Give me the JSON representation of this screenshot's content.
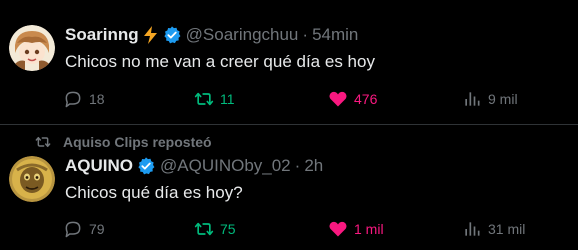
{
  "tweets": [
    {
      "author_name": "Soarinng",
      "handle": "@Soaringchuu",
      "separator": "·",
      "time": "54min",
      "text": "Chicos no me van a creer qué día es hoy",
      "reply_count": "18",
      "retweet_count": "11",
      "like_count": "476",
      "view_count": "9 mil",
      "liked": true,
      "retweeted": true
    },
    {
      "repost_text": "Aquiso Clips reposteó",
      "author_name": "AQUINO",
      "handle": "@AQUINOby_02",
      "separator": "·",
      "time": "2h",
      "text": "Chicos qué día es hoy?",
      "reply_count": "79",
      "retweet_count": "75",
      "like_count": "1 mil",
      "view_count": "31 mil",
      "liked": true,
      "retweeted": true
    }
  ],
  "colors": {
    "background": "#000000",
    "text_primary": "#e7e9ea",
    "text_secondary": "#71767b",
    "verified_blue": "#1d9bf0",
    "retweet_green": "#00ba7c",
    "like_pink": "#f91880",
    "divider": "#2f3336"
  },
  "icons": {
    "emoji": "lightning-emoji-icon",
    "verified": "verified-badge-icon",
    "reply": "reply-icon",
    "retweet": "retweet-icon",
    "like": "heart-icon",
    "views": "views-chart-icon",
    "repost": "repost-icon"
  }
}
